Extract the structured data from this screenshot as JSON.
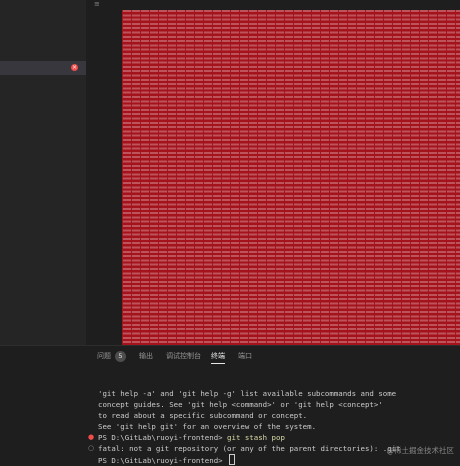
{
  "panel": {
    "tabs": [
      {
        "label": "问题",
        "badge": "5"
      },
      {
        "label": "输出"
      },
      {
        "label": "调试控制台"
      },
      {
        "label": "终端",
        "active": true
      },
      {
        "label": "端口"
      }
    ]
  },
  "terminal": {
    "lines": [
      "'git help -a' and 'git help -g' list available subcommands and some",
      "concept guides. See 'git help <command>' or 'git help <concept>'",
      "to read about a specific subcommand or concept.",
      "See 'git help git' for an overview of the system."
    ],
    "prompt1": "PS D:\\GitLab\\ruoyi-frontend> ",
    "command1": "git stash pop",
    "error": "fatal: not a git repository (or any of the parent directories): .git",
    "prompt2": "PS D:\\GitLab\\ruoyi-frontend> "
  },
  "watermark": "@稀土掘金技术社区",
  "colors": {
    "highlight": "#a4121c",
    "error": "#f14c4c",
    "command": "#dcdcaa"
  }
}
